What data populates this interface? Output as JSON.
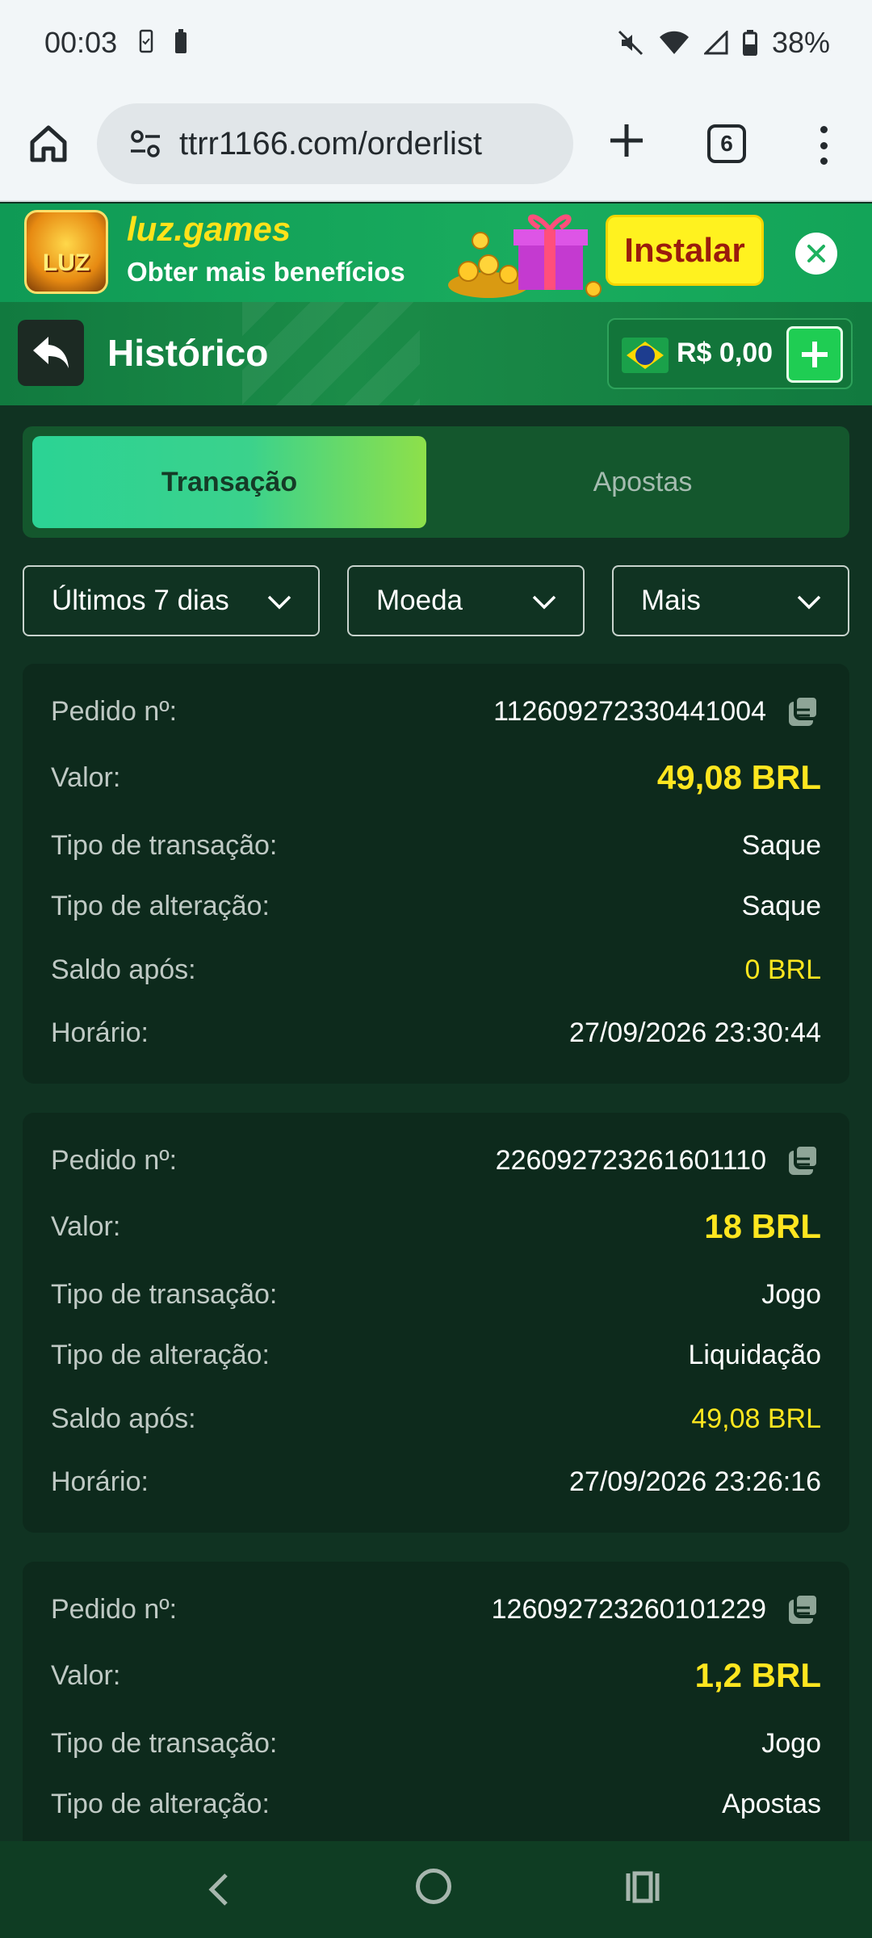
{
  "status_bar": {
    "time": "00:03",
    "battery": "38%"
  },
  "browser": {
    "url": "ttrr1166.com/orderlist",
    "tab_count": "6"
  },
  "banner": {
    "logo_text": "LUZ",
    "title": "luz.games",
    "subtitle": "Obter mais benefícios",
    "install_label": "Instalar"
  },
  "header": {
    "title": "Histórico",
    "balance": "R$ 0,00"
  },
  "tabs": [
    {
      "label": "Transação",
      "active": true
    },
    {
      "label": "Apostas",
      "active": false
    }
  ],
  "filters": {
    "period": "Últimos 7 dias",
    "currency": "Moeda",
    "more": "Mais"
  },
  "labels": {
    "order": "Pedido nº:",
    "value": "Valor:",
    "tx_type": "Tipo de transação:",
    "change_type": "Tipo de alteração:",
    "balance_after": "Saldo após:",
    "time": "Horário:"
  },
  "transactions": [
    {
      "order_no": "112609272330441004",
      "value": "49,08 BRL",
      "tx_type": "Saque",
      "change_type": "Saque",
      "balance_after": "0 BRL",
      "time": "27/09/2026 23:30:44"
    },
    {
      "order_no": "226092723261601110",
      "value": "18 BRL",
      "tx_type": "Jogo",
      "change_type": "Liquidação",
      "balance_after": "49,08 BRL",
      "time": "27/09/2026 23:26:16"
    },
    {
      "order_no": "126092723260101229",
      "value": "1,2 BRL",
      "tx_type": "Jogo",
      "change_type": "Apostas"
    }
  ],
  "colors": {
    "accent_yellow": "#ffe61f",
    "header_green": "#117a3f",
    "page_bg": "#103322",
    "card_bg": "#0d2a1c"
  }
}
